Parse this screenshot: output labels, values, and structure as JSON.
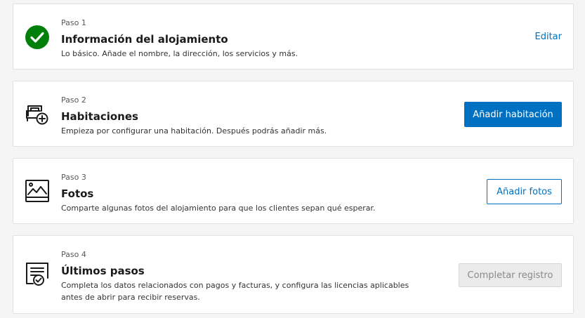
{
  "colors": {
    "accent": "#0071c2",
    "success": "#008009",
    "background": "#f5f5f5",
    "disabled_bg": "#ebebeb"
  },
  "steps": [
    {
      "label": "Paso 1",
      "title": "Información del alojamiento",
      "description": "Lo básico. Añade el nombre, la dirección, los servicios y más.",
      "icon": "checkmark-circle-icon",
      "action": "Editar",
      "status": "completed"
    },
    {
      "label": "Paso 2",
      "title": "Habitaciones",
      "description": "Empieza por configurar una habitación. Después podrás añadir más.",
      "icon": "bed-add-icon",
      "action": "Añadir habitación"
    },
    {
      "label": "Paso 3",
      "title": "Fotos",
      "description": "Comparte algunas fotos del alojamiento para que los clientes sepan qué esperar.",
      "icon": "image-icon",
      "action": "Añadir fotos"
    },
    {
      "label": "Paso 4",
      "title": "Últimos pasos",
      "description": "Completa los datos relacionados con pagos y facturas, y configura las licencias aplicables antes de abrir para recibir reservas.",
      "icon": "document-check-icon",
      "action": "Completar registro",
      "status": "disabled"
    }
  ]
}
